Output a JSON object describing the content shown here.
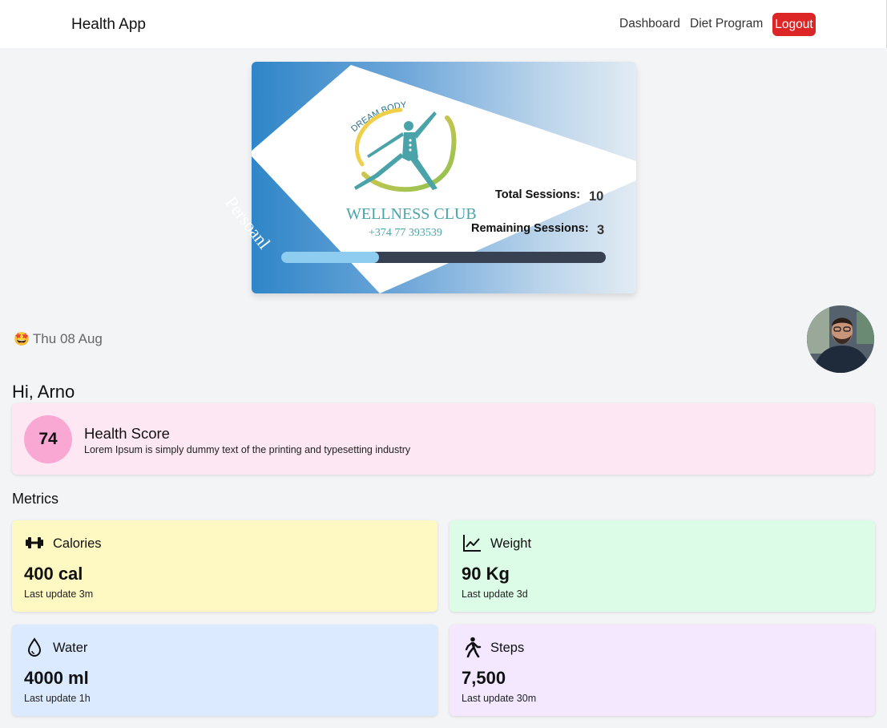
{
  "nav": {
    "brand": "Health App",
    "links": [
      "Dashboard",
      "Diet Program"
    ],
    "logout_label": "Logout"
  },
  "club_card": {
    "tag": "Persoanl",
    "logo": {
      "arc_text": "DREAM BODY",
      "name": "WELLNESS CLUB",
      "phone": "+374 77 393539"
    },
    "total_sessions_label": "Total Sessions:",
    "total_sessions_value": "10",
    "remaining_sessions_label": "Remaining Sessions:",
    "remaining_sessions_value": "3",
    "progress": 0.3,
    "colors": {
      "progress_fill": "#8ecdf0",
      "progress_track": "#374151",
      "logo_teal": "#4aa3a8"
    }
  },
  "date": {
    "emoji": "🤩",
    "text": "Thu 08 Aug"
  },
  "greeting": "Hi, Arno",
  "health_score": {
    "value": "74",
    "title": "Health Score",
    "description": "Lorem Ipsum is simply dummy text of the printing and typesetting industry",
    "colors": {
      "card": "#fce7f3",
      "circle": "#f9a8d4"
    }
  },
  "metrics": {
    "heading": "Metrics",
    "items": [
      {
        "label": "Calories",
        "value": "400 cal",
        "update": "Last update 3m",
        "icon": "dumbbell-icon",
        "color": "#fef9c3"
      },
      {
        "label": "Weight",
        "value": "90 Kg",
        "update": "Last update 3d",
        "icon": "chart-line-icon",
        "color": "#dcfce7"
      },
      {
        "label": "Water",
        "value": "4000 ml",
        "update": "Last update 1h",
        "icon": "water-drop-icon",
        "color": "#dbeafe"
      },
      {
        "label": "Steps",
        "value": "7,500",
        "update": "Last update 30m",
        "icon": "walking-icon",
        "color": "#f3e8ff"
      }
    ]
  }
}
